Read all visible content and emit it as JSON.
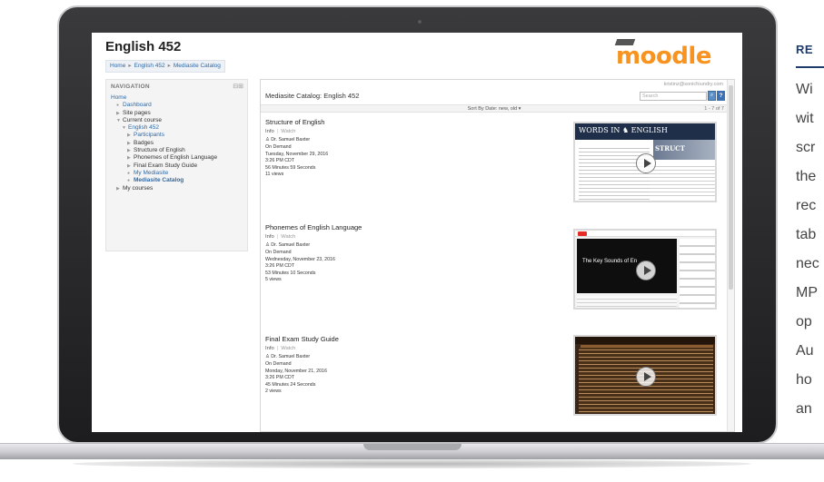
{
  "page": {
    "course_title": "English 452",
    "breadcrumb": [
      "Home",
      "English 452",
      "Mediasite Catalog"
    ],
    "breadcrumb_sep": "▸",
    "logo": "moodle"
  },
  "nav": {
    "heading": "NAVIGATION",
    "controls": "⊟⊞",
    "items": [
      {
        "glyph": "",
        "label": "Home",
        "link": true,
        "bold": false,
        "indent": 0
      },
      {
        "glyph": "●",
        "label": "Dashboard",
        "link": true,
        "bold": false,
        "indent": 1
      },
      {
        "glyph": "▶",
        "label": "Site pages",
        "link": false,
        "bold": false,
        "indent": 1
      },
      {
        "glyph": "▼",
        "label": "Current course",
        "link": false,
        "bold": false,
        "indent": 1
      },
      {
        "glyph": "▼",
        "label": "English 452",
        "link": true,
        "bold": false,
        "indent": 2
      },
      {
        "glyph": "▶",
        "label": "Participants",
        "link": true,
        "bold": false,
        "indent": 3
      },
      {
        "glyph": "▶",
        "label": "Badges",
        "link": false,
        "bold": false,
        "indent": 3
      },
      {
        "glyph": "▶",
        "label": "Structure of English",
        "link": false,
        "bold": false,
        "indent": 3
      },
      {
        "glyph": "▶",
        "label": "Phonemes of English Language",
        "link": false,
        "bold": false,
        "indent": 3
      },
      {
        "glyph": "▶",
        "label": "Final Exam Study Guide",
        "link": false,
        "bold": false,
        "indent": 3
      },
      {
        "glyph": "●",
        "label": "My Mediasite",
        "link": true,
        "bold": false,
        "indent": 3
      },
      {
        "glyph": "●",
        "label": "Mediasite Catalog",
        "link": true,
        "bold": true,
        "indent": 3
      },
      {
        "glyph": "▶",
        "label": "My courses",
        "link": false,
        "bold": false,
        "indent": 1
      }
    ]
  },
  "catalog": {
    "user_email": "kristinz@sonicfoundry.com",
    "title": "Mediasite Catalog: English 452",
    "search_placeholder": "Search",
    "search_icon": "⌕",
    "help_label": "?",
    "sort_label": "Sort By Date: new, old ▾",
    "count": "1 - 7 of 7",
    "tab_info": "Info",
    "tab_sep": "|",
    "tab_watch": "Watch",
    "presentations": [
      {
        "title": "Structure of English",
        "presenter": "♙ Dr. Samuel Baxter",
        "availability": "On Demand",
        "date": "Tuesday, November 29, 2016",
        "time": "3:26 PM CDT",
        "duration": "56 Minutes 59 Seconds",
        "views": "11 views",
        "thumb_banner": "WORDS IN ♞ ENGLISH",
        "thumb_img_text": "STRUCT"
      },
      {
        "title": "Phonemes of English Language",
        "presenter": "♙ Dr. Samuel Baxter",
        "availability": "On Demand",
        "date": "Wednesday, November 23, 2016",
        "time": "3:26 PM CDT",
        "duration": "53 Minutes 10 Seconds",
        "views": "5 views",
        "thumb_video_text": "The Key Sounds of En"
      },
      {
        "title": "Final Exam Study Guide",
        "presenter": "♙ Dr. Samuel Baxter",
        "availability": "On Demand",
        "date": "Monday, November 21, 2016",
        "time": "3:26 PM CDT",
        "duration": "45 Minutes 24 Seconds",
        "views": "2 views"
      }
    ]
  },
  "side_text": {
    "heading": "RE",
    "lines": [
      "Wi",
      "wit",
      "scr",
      "the",
      "rec",
      "tab",
      "nec",
      "MP",
      "op",
      "Au",
      "ho",
      "an"
    ]
  },
  "colors": {
    "link": "#2f6aa8",
    "moodle_orange": "#f7931e",
    "side_heading": "#1d3b6e"
  }
}
